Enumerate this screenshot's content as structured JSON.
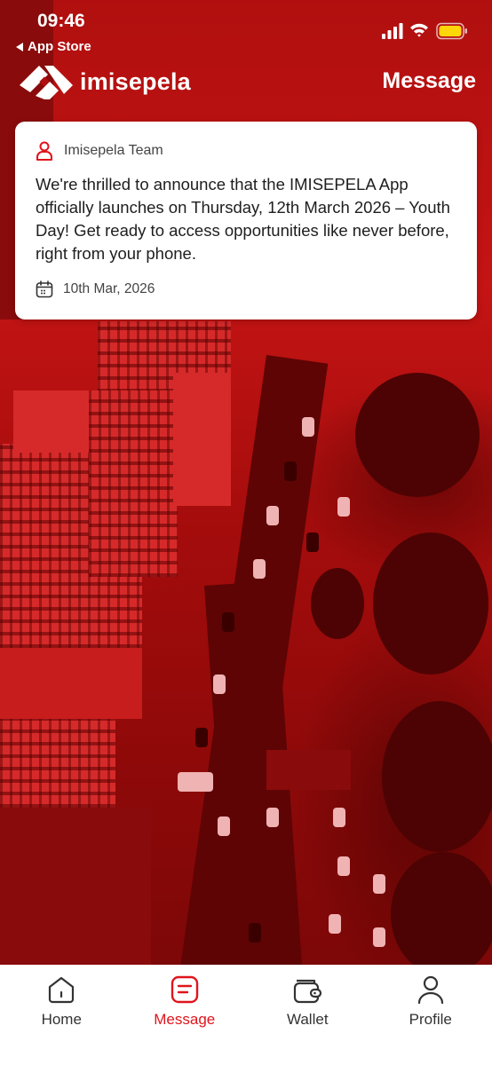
{
  "status_bar": {
    "time": "09:46",
    "back_label": "App Store"
  },
  "header": {
    "logo_text": "imisepela",
    "title": "Message"
  },
  "message": {
    "author": "Imisepela Team",
    "body": "We're thrilled to announce that the IMISEPELA App officially launches on Thursday, 12th March 2026 – Youth Day! Get ready to access opportunities like never before, right from your phone.",
    "date": "10th Mar, 2026"
  },
  "bottom_nav": {
    "items": [
      {
        "label": "Home",
        "icon": "home-icon",
        "active": false
      },
      {
        "label": "Message",
        "icon": "message-icon",
        "active": true
      },
      {
        "label": "Wallet",
        "icon": "wallet-icon",
        "active": false
      },
      {
        "label": "Profile",
        "icon": "profile-icon",
        "active": false
      }
    ]
  },
  "colors": {
    "accent": "#e0141c",
    "background_tint": "#b10f0f"
  }
}
